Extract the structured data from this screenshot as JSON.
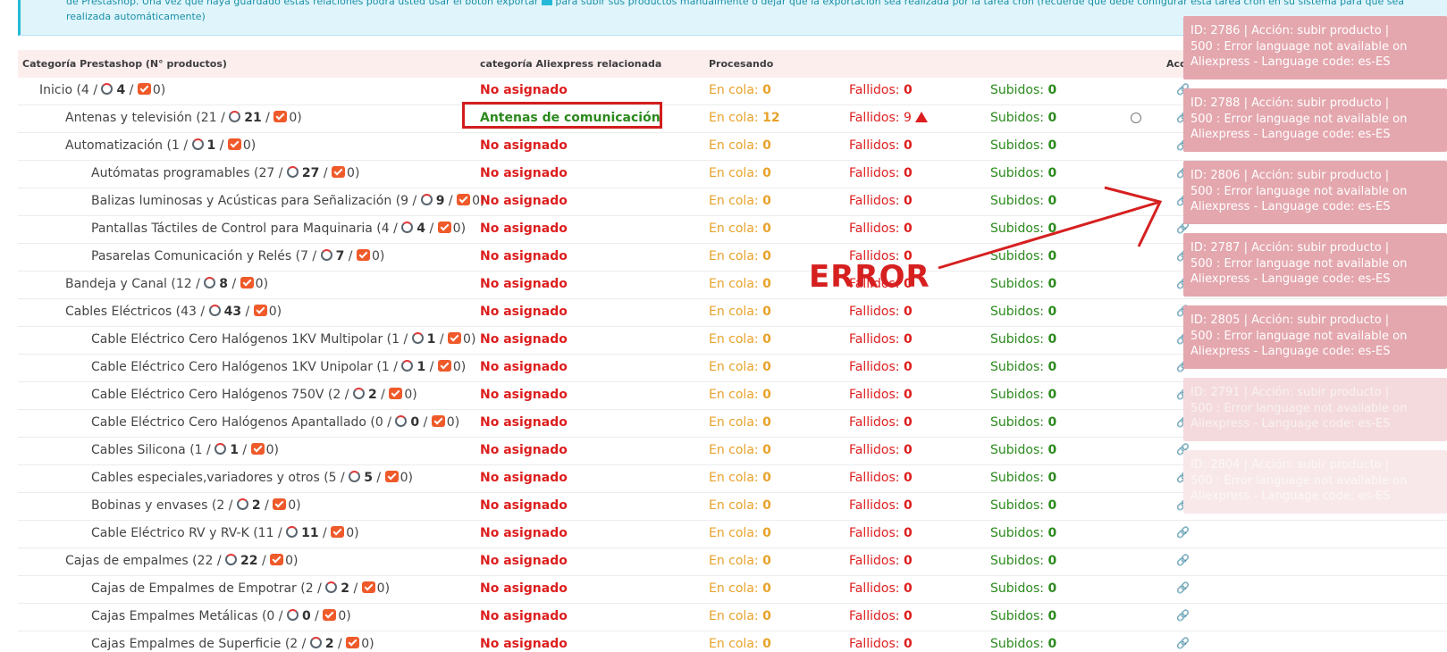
{
  "info": {
    "line1": "de Prestashop. Una vez que haya guardado estas relaciones podrá usted usar el botón exportar",
    "line1b": "para subir sus productos manualmente o dejar que la exportación sea realizada por la tarea cron (recuerde que debe configurar esta tarea cron en su sistema para que sea",
    "line2": "realizada automáticamente)"
  },
  "table": {
    "headers": {
      "category": "Categoría Prestashop (N° productos)",
      "aliexpress": "categoría Aliexpress relacionada",
      "processing": "Procesando",
      "actions": "Acciones"
    },
    "labels": {
      "queue": "En cola:",
      "failed": "Fallidos:",
      "uploaded": "Subidos:",
      "unassigned": "No asignado"
    },
    "rows": [
      {
        "name": "Inicio (4 /",
        "ps": "4",
        "ae": "0",
        "cat": "No asignado",
        "queue": "0",
        "failed": "0",
        "up": "0"
      },
      {
        "name": "Antenas y televisión (21 /",
        "ps": "21",
        "ae": "0",
        "cat": "Antenas de comunicación",
        "queue": "12",
        "failed": "9",
        "up": "0"
      },
      {
        "name": "Automatización (1 /",
        "ps": "1",
        "ae": "0",
        "cat": "No asignado",
        "queue": "0",
        "failed": "0",
        "up": "0"
      },
      {
        "name": "Autómatas programables (27 /",
        "ps": "27",
        "ae": "0",
        "cat": "No asignado",
        "queue": "0",
        "failed": "0",
        "up": "0"
      },
      {
        "name": "Balizas luminosas y Acústicas para Señalización (9 /",
        "ps": "9",
        "ae": "0",
        "cat": "No asignado",
        "queue": "0",
        "failed": "0",
        "up": "0"
      },
      {
        "name": "Pantallas Táctiles de Control para Maquinaria (4 /",
        "ps": "4",
        "ae": "0",
        "cat": "No asignado",
        "queue": "0",
        "failed": "0",
        "up": "0"
      },
      {
        "name": "Pasarelas Comunicación y Relés (7 /",
        "ps": "7",
        "ae": "0",
        "cat": "No asignado",
        "queue": "0",
        "failed": "0",
        "up": "0"
      },
      {
        "name": "Bandeja y Canal (12 /",
        "ps": "8",
        "ae": "0",
        "cat": "No asignado",
        "queue": "0",
        "failed": "0",
        "up": "0"
      },
      {
        "name": "Cables Eléctricos (43 /",
        "ps": "43",
        "ae": "0",
        "cat": "No asignado",
        "queue": "0",
        "failed": "0",
        "up": "0"
      },
      {
        "name": "Cable Eléctrico Cero Halógenos 1KV Multipolar (1 /",
        "ps": "1",
        "ae": "0",
        "cat": "No asignado",
        "queue": "0",
        "failed": "0",
        "up": "0"
      },
      {
        "name": "Cable Eléctrico Cero Halógenos 1KV Unipolar (1 /",
        "ps": "1",
        "ae": "0",
        "cat": "No asignado",
        "queue": "0",
        "failed": "0",
        "up": "0"
      },
      {
        "name": "Cable Eléctrico Cero Halógenos 750V (2 /",
        "ps": "2",
        "ae": "0",
        "cat": "No asignado",
        "queue": "0",
        "failed": "0",
        "up": "0"
      },
      {
        "name": "Cable Eléctrico Cero Halógenos Apantallado (0 /",
        "ps": "0",
        "ae": "0",
        "cat": "No asignado",
        "queue": "0",
        "failed": "0",
        "up": "0"
      },
      {
        "name": "Cables Silicona (1 /",
        "ps": "1",
        "ae": "0",
        "cat": "No asignado",
        "queue": "0",
        "failed": "0",
        "up": "0"
      },
      {
        "name": "Cables especiales,variadores y otros (5 /",
        "ps": "5",
        "ae": "0",
        "cat": "No asignado",
        "queue": "0",
        "failed": "0",
        "up": "0"
      },
      {
        "name": "Bobinas y envases (2 /",
        "ps": "2",
        "ae": "0",
        "cat": "No asignado",
        "queue": "0",
        "failed": "0",
        "up": "0"
      },
      {
        "name": "Cable Eléctrico RV y RV-K (11 /",
        "ps": "11",
        "ae": "0",
        "cat": "No asignado",
        "queue": "0",
        "failed": "0",
        "up": "0"
      },
      {
        "name": "Cajas de empalmes (22 /",
        "ps": "22",
        "ae": "0",
        "cat": "No asignado",
        "queue": "0",
        "failed": "0",
        "up": "0"
      },
      {
        "name": "Cajas de Empalmes de Empotrar (2 /",
        "ps": "2",
        "ae": "0",
        "cat": "No asignado",
        "queue": "0",
        "failed": "0",
        "up": "0"
      },
      {
        "name": "Cajas Empalmes Metálicas (0 /",
        "ps": "0",
        "ae": "0",
        "cat": "No asignado",
        "queue": "0",
        "failed": "0",
        "up": "0"
      },
      {
        "name": "Cajas Empalmes de Superficie (2 /",
        "ps": "2",
        "ae": "0",
        "cat": "No asignado",
        "queue": "0",
        "failed": "0",
        "up": "0"
      }
    ]
  },
  "annotation": {
    "text": "ERROR"
  },
  "toasts": [
    {
      "line1": "ID: 2786 | Acción: subir producto |",
      "line2": "500 : Error language not available on",
      "line3": "Aliexpress - Language code: es-ES"
    },
    {
      "line1": "ID: 2788 | Acción: subir producto |",
      "line2": "500 : Error language not available on",
      "line3": "Aliexpress - Language code: es-ES"
    },
    {
      "line1": "ID: 2806 | Acción: subir producto |",
      "line2": "500 : Error language not available on",
      "line3": "Aliexpress - Language code: es-ES"
    },
    {
      "line1": "ID: 2787 | Acción: subir producto |",
      "line2": "500 : Error language not available on",
      "line3": "Aliexpress - Language code: es-ES"
    },
    {
      "line1": "ID: 2805 | Acción: subir producto |",
      "line2": "500 : Error language not available on",
      "line3": "Aliexpress - Language code: es-ES"
    },
    {
      "line1": "ID: 2791 | Acción: subir producto |",
      "line2": "500 : Error language not available on",
      "line3": "Aliexpress - Language code: es-ES"
    },
    {
      "line1": "ID: 2804 | Acción: subir producto |",
      "line2": "500 : Error language not available on",
      "line3": "Aliexpress - Language code: es-ES"
    }
  ],
  "colors": {
    "accent": "#25b9d7",
    "error": "#dd1e1e",
    "success": "#2b8a1d",
    "queue": "#e8a22a",
    "toast": "#e4a7ae"
  }
}
